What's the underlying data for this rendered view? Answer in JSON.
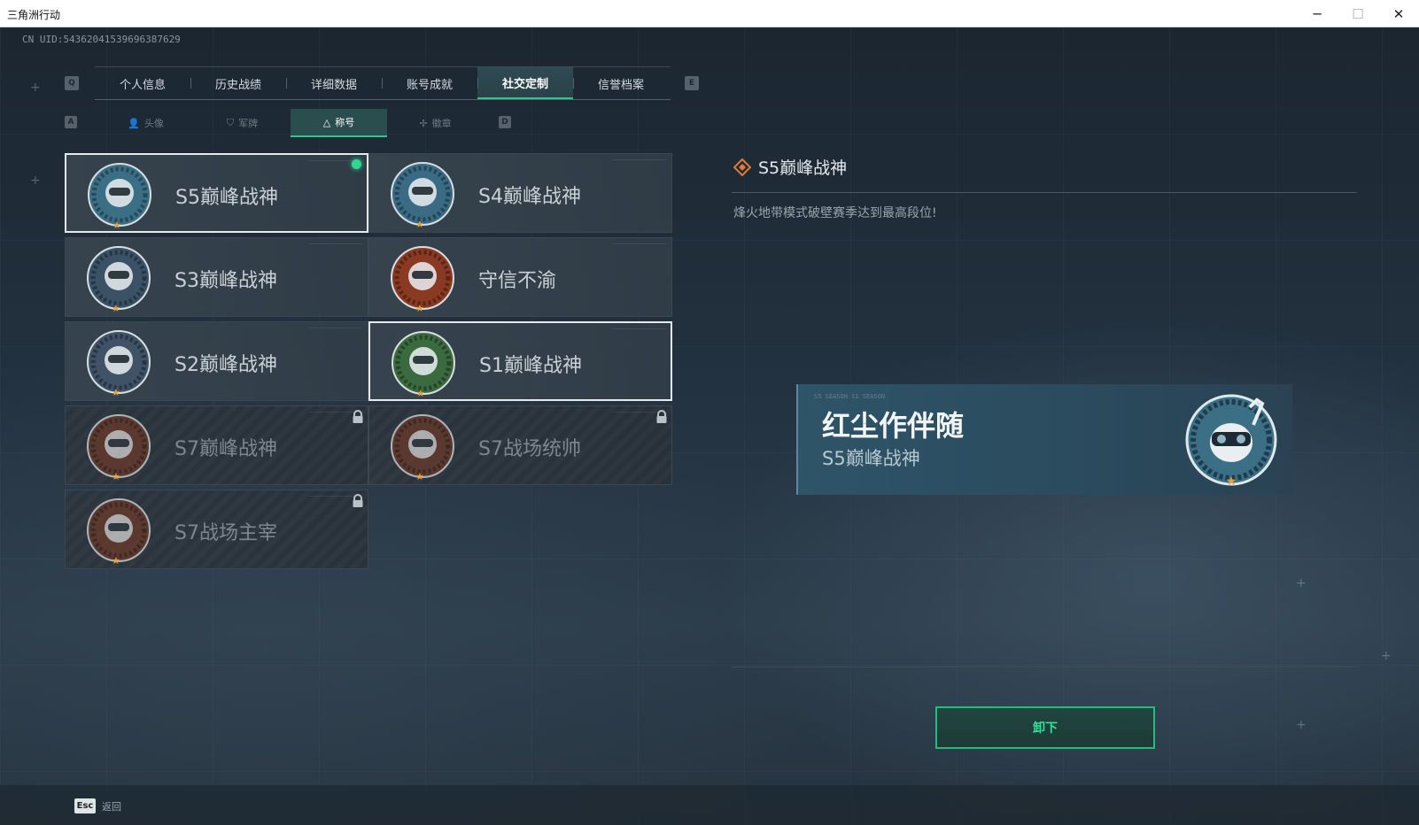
{
  "window": {
    "title": "三角洲行动",
    "min_icon": "─",
    "max_icon": "☐",
    "close_icon": "✕"
  },
  "header": {
    "uid": "CN UID:5436204153969638762​9"
  },
  "tabs": {
    "prev_key": "Q",
    "next_key": "E",
    "items": [
      {
        "label": "个人信息"
      },
      {
        "label": "历史战绩"
      },
      {
        "label": "详细数据"
      },
      {
        "label": "账号成就"
      },
      {
        "label": "社交定制",
        "active": true
      },
      {
        "label": "信誉档案"
      }
    ]
  },
  "subtabs": {
    "prev_key": "A",
    "next_key": "D",
    "items": [
      {
        "label": "头像",
        "icon": "person-icon"
      },
      {
        "label": "军牌",
        "icon": "dogtag-icon"
      },
      {
        "label": "称号",
        "icon": "triangle-icon",
        "active": true
      },
      {
        "label": "徽章",
        "icon": "emblem-icon"
      }
    ]
  },
  "titles": [
    {
      "label": "S5巅峰战神",
      "badge": "diver-skull-badge",
      "equipped": true,
      "locked": false,
      "selected": true,
      "badge_color": "#3b6f86"
    },
    {
      "label": "S4巅峰战神",
      "badge": "night-vision-helmet-badge",
      "equipped": false,
      "locked": false,
      "selected": false,
      "badge_color": "#3a6a84"
    },
    {
      "label": "S3巅峰战神",
      "badge": "armillary-skull-badge",
      "equipped": false,
      "locked": false,
      "selected": false,
      "badge_color": "#3b5266"
    },
    {
      "label": "守信不渝",
      "badge": "scales-badge",
      "equipped": false,
      "locked": false,
      "selected": false,
      "badge_color": "#8a3a22"
    },
    {
      "label": "S2巅峰战神",
      "badge": "triangle-emblem-badge",
      "equipped": false,
      "locked": false,
      "selected": false,
      "badge_color": "#3f5266"
    },
    {
      "label": "S1巅峰战神",
      "badge": "crocodile-badge",
      "equipped": false,
      "locked": false,
      "selected": true,
      "badge_color": "#3b6a3e"
    },
    {
      "label": "S7巅峰战神",
      "badge": "crossbow-badge",
      "equipped": false,
      "locked": true,
      "selected": false,
      "badge_color": "#6a3a2a"
    },
    {
      "label": "S7战场统帅",
      "badge": "armored-vehicle-badge",
      "equipped": false,
      "locked": true,
      "selected": false,
      "badge_color": "#6a3a2a"
    },
    {
      "label": "S7战场主宰",
      "badge": "warrior-face-badge",
      "equipped": false,
      "locked": true,
      "selected": false,
      "badge_color": "#6a3a2a"
    }
  ],
  "detail": {
    "title": "S5巅峰战神",
    "description": "烽火地带模式破壁赛季达到最高段位!"
  },
  "nameplate": {
    "tiny_text": "S5 SEASON   S1 SEASON",
    "player_name": "红尘作伴随",
    "title": "S5巅峰战神"
  },
  "actions": {
    "unequip_label": "卸下"
  },
  "footer": {
    "esc_key": "Esc",
    "back_label": "返回"
  },
  "colors": {
    "accent": "#2fc58c",
    "equipped_dot": "#2fd88f",
    "star": "#e8a23a"
  }
}
